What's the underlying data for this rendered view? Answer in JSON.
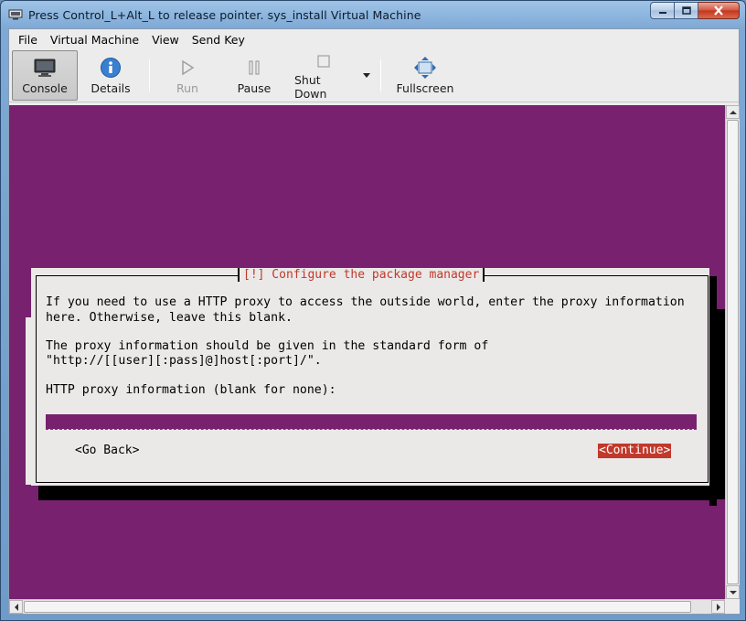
{
  "window": {
    "title": "Press Control_L+Alt_L to release pointer. sys_install Virtual Machine",
    "icon": "vm-monitor-icon"
  },
  "menubar": {
    "items": [
      "File",
      "Virtual Machine",
      "View",
      "Send Key"
    ]
  },
  "toolbar": {
    "console_label": "Console",
    "details_label": "Details",
    "run_label": "Run",
    "pause_label": "Pause",
    "shutdown_label": "Shut Down",
    "fullscreen_label": "Fullscreen"
  },
  "dialog": {
    "title": "[!] Configure the package manager",
    "paragraph1_line1": "If you need to use a HTTP proxy to access the outside world, enter the proxy information",
    "paragraph1_line2": "here. Otherwise, leave this blank.",
    "paragraph2_line1": "The proxy information should be given in the standard form of",
    "paragraph2_line2": "\"http://[[user][:pass]@]host[:port]/\".",
    "field_label": "HTTP proxy information (blank for none):",
    "field_value": "",
    "go_back_label": "<Go Back>",
    "continue_label": "<Continue>"
  },
  "colors": {
    "console_bg": "#77216f",
    "dialog_bg": "#ebe8e8",
    "accent_red": "#c0392b"
  }
}
